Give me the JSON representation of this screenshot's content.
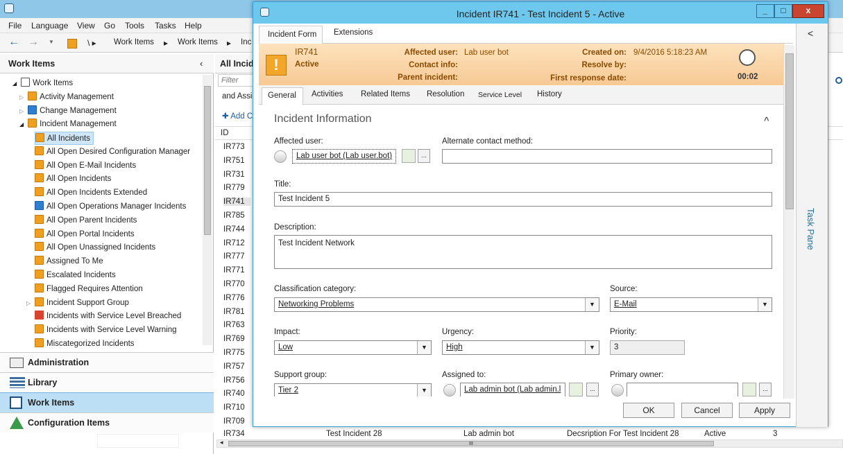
{
  "console": {
    "menu": [
      "File",
      "Language",
      "View",
      "Go",
      "Tools",
      "Tasks",
      "Help"
    ],
    "breadcrumb": [
      "Work Items",
      "Work Items",
      "Inc"
    ],
    "left_header": "Work Items",
    "mid_header": "All Incid",
    "filter_placeholder": "Filter",
    "mid_snippet_1": "and Assi",
    "mid_add": "Add C",
    "id_header": "ID",
    "tree_root": "Work Items",
    "tree": [
      {
        "label": "Activity Management",
        "icon": "activity-icon"
      },
      {
        "label": "Change Management",
        "icon": "change-icon"
      },
      {
        "label": "Incident Management",
        "icon": "incident-icon"
      },
      {
        "label": "All Incidents",
        "icon": "incident-view-icon",
        "selected": true
      },
      {
        "label": "All Open Desired Configuration Manager",
        "icon": "incident-view-icon"
      },
      {
        "label": "All Open E-Mail Incidents",
        "icon": "email-incident-icon"
      },
      {
        "label": "All Open Incidents",
        "icon": "incident-view-icon"
      },
      {
        "label": "All Open Incidents Extended",
        "icon": "incident-view-icon"
      },
      {
        "label": "All Open Operations Manager Incidents",
        "icon": "opsmgr-icon"
      },
      {
        "label": "All Open Parent Incidents",
        "icon": "parent-incident-icon"
      },
      {
        "label": "All Open Portal Incidents",
        "icon": "portal-icon"
      },
      {
        "label": "All Open Unassigned Incidents",
        "icon": "incident-view-icon"
      },
      {
        "label": "Assigned To Me",
        "icon": "assigned-icon"
      },
      {
        "label": "Escalated Incidents",
        "icon": "escalated-icon"
      },
      {
        "label": "Flagged Requires Attention",
        "icon": "flag-icon"
      },
      {
        "label": "Incident Support Group",
        "icon": "incident-view-icon"
      },
      {
        "label": "Incidents with Service Level Breached",
        "icon": "breached-icon"
      },
      {
        "label": "Incidents with Service Level Warning",
        "icon": "warning-icon"
      },
      {
        "label": "Miscategorized Incidents",
        "icon": "incident-view-icon"
      }
    ],
    "wunderbar": [
      "Administration",
      "Library",
      "Work Items",
      "Configuration Items"
    ],
    "ids": [
      "IR773",
      "IR751",
      "IR731",
      "IR779",
      "IR741",
      "IR785",
      "IR744",
      "IR712",
      "IR777",
      "IR771",
      "IR770",
      "IR776",
      "IR781",
      "IR763",
      "IR769",
      "IR775",
      "IR757",
      "IR756",
      "IR740",
      "IR710",
      "IR709",
      "IR734"
    ],
    "bottom_row": {
      "title": "Test Incident 28",
      "assigned": "Lab admin bot",
      "desc": "Decsription For Test Incident 28",
      "status": "Active",
      "priority": "3"
    },
    "hscroll_glyph": "III"
  },
  "dialog": {
    "title": "Incident IR741 - Test Incident 5 - Active",
    "top_tabs": [
      "Incident Form",
      "Extensions"
    ],
    "banner": {
      "id": "IR741",
      "status": "Active",
      "affected_user_label": "Affected user:",
      "affected_user": "Lab user bot",
      "contact_info_label": "Contact info:",
      "parent_incident_label": "Parent incident:",
      "created_on_label": "Created on:",
      "created_on": "9/4/2016 5:18:23 AM",
      "resolve_by_label": "Resolve by:",
      "first_response_label": "First response date:",
      "timer": "00:02",
      "alert_glyph": "!"
    },
    "tabs": [
      "General",
      "Activities",
      "Related Items",
      "Resolution",
      "Service Level",
      "History"
    ],
    "section_title": "Incident Information",
    "fields": {
      "affected_user_label": "Affected user:",
      "affected_user": "Lab user bot (Lab user.bot)",
      "alt_contact_label": "Alternate contact method:",
      "alt_contact": "",
      "title_label": "Title:",
      "title": "Test Incident 5",
      "description_label": "Description:",
      "description": "Test Incident Network",
      "classification_label": "Classification category:",
      "classification": "Networking Problems",
      "source_label": "Source:",
      "source": "E-Mail",
      "impact_label": "Impact:",
      "impact": "Low",
      "urgency_label": "Urgency:",
      "urgency": "High",
      "priority_label": "Priority:",
      "priority": "3",
      "support_group_label": "Support group:",
      "support_group": "Tier 2",
      "assigned_to_label": "Assigned to:",
      "assigned_to": "Lab admin bot (Lab admin.l",
      "primary_owner_label": "Primary owner:",
      "primary_owner": ""
    },
    "buttons": {
      "ok": "OK",
      "cancel": "Cancel",
      "apply": "Apply",
      "ellipsis": "...",
      "minimize": "_",
      "maximize": "□",
      "close": "x",
      "collapse": "^",
      "back": "<"
    },
    "task_pane": "Task Pane"
  }
}
